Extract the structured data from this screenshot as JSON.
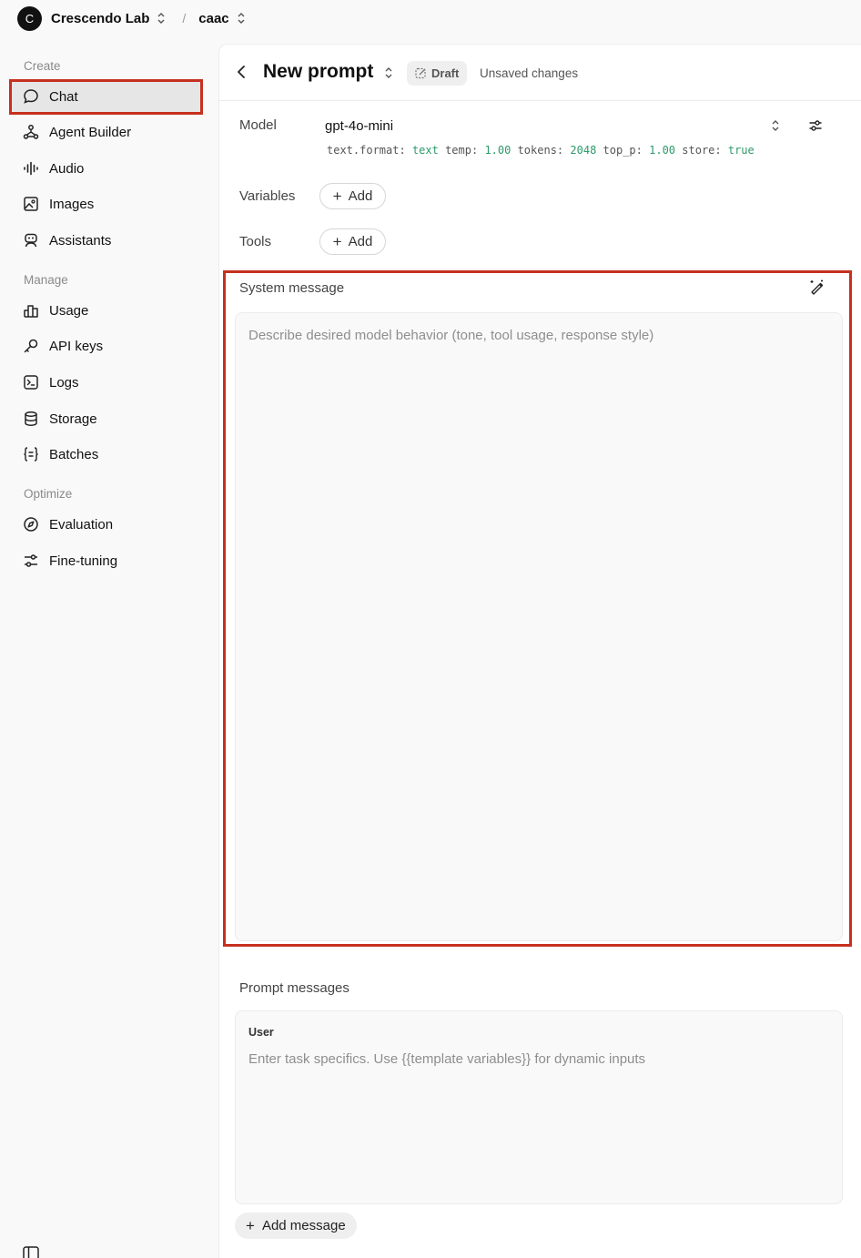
{
  "org": {
    "initial": "C",
    "name": "Crescendo Lab"
  },
  "breadcrumb_sep": "/",
  "project": {
    "name": "caac"
  },
  "sidebar": {
    "sections": [
      {
        "label": "Create"
      },
      {
        "label": "Manage"
      },
      {
        "label": "Optimize"
      }
    ],
    "items": [
      {
        "label": "Chat",
        "icon": "chat-bubble-icon",
        "active": true
      },
      {
        "label": "Agent Builder",
        "icon": "agent-graph-icon"
      },
      {
        "label": "Audio",
        "icon": "audio-wave-icon"
      },
      {
        "label": "Images",
        "icon": "image-icon"
      },
      {
        "label": "Assistants",
        "icon": "robot-icon"
      },
      {
        "label": "Usage",
        "icon": "bar-chart-icon"
      },
      {
        "label": "API keys",
        "icon": "key-icon"
      },
      {
        "label": "Logs",
        "icon": "terminal-icon"
      },
      {
        "label": "Storage",
        "icon": "database-icon"
      },
      {
        "label": "Batches",
        "icon": "braces-icon"
      },
      {
        "label": "Evaluation",
        "icon": "compass-icon"
      },
      {
        "label": "Fine-tuning",
        "icon": "sliders-icon"
      }
    ]
  },
  "header": {
    "title": "New prompt",
    "badge": "Draft",
    "status": "Unsaved changes"
  },
  "model": {
    "label": "Model",
    "name": "gpt-4o-mini",
    "params": [
      {
        "key": "text.format:",
        "value": "text"
      },
      {
        "key": "temp:",
        "value": "1.00"
      },
      {
        "key": "tokens:",
        "value": "2048"
      },
      {
        "key": "top_p:",
        "value": "1.00"
      },
      {
        "key": "store:",
        "value": "true"
      }
    ]
  },
  "variables": {
    "label": "Variables",
    "add_label": "Add"
  },
  "tools": {
    "label": "Tools",
    "add_label": "Add"
  },
  "system_message": {
    "label": "System message",
    "placeholder": "Describe desired model behavior (tone, tool usage, response style)"
  },
  "prompt_messages": {
    "label": "Prompt messages",
    "role": "User",
    "placeholder": "Enter task specifics. Use {{template variables}} for dynamic inputs",
    "add_label": "Add message"
  },
  "colors": {
    "highlight": "#c5301f",
    "param_value": "#2e9a6b"
  }
}
